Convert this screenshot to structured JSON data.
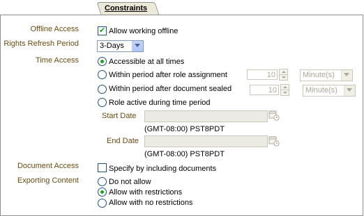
{
  "tab": {
    "label": "Constraints"
  },
  "offline_access": {
    "label": "Offline Access",
    "checkbox_label": "Allow working offline",
    "checked": true
  },
  "rights_refresh": {
    "label": "Rights Refresh Period",
    "selected": "3-Days"
  },
  "time_access": {
    "label": "Time Access",
    "options": [
      "Accessible at all times",
      "Within period after role assignment",
      "Within period after document sealed",
      "Role active during time period"
    ],
    "selected_index": 0,
    "role_assignment_value": "10",
    "role_assignment_unit": "Minute(s)",
    "document_sealed_value": "10",
    "document_sealed_unit": "Minute(s)",
    "start_date_label": "Start Date",
    "start_timezone": "(GMT-08:00) PST8PDT",
    "end_date_label": "End Date",
    "end_timezone": "(GMT-08:00) PST8PDT"
  },
  "document_access": {
    "label": "Document Access",
    "checkbox_label": "Specify by including documents",
    "checked": false
  },
  "exporting_content": {
    "label": "Exporting Content",
    "options": [
      "Do not allow",
      "Allow with restrictions",
      "Allow with no restrictions"
    ],
    "selected_index": 1
  },
  "colors": {
    "label_text": "#6b4a10",
    "accent_green": "#21a121",
    "control_border": "#1c5180",
    "disabled_fill": "#ecebe3"
  }
}
